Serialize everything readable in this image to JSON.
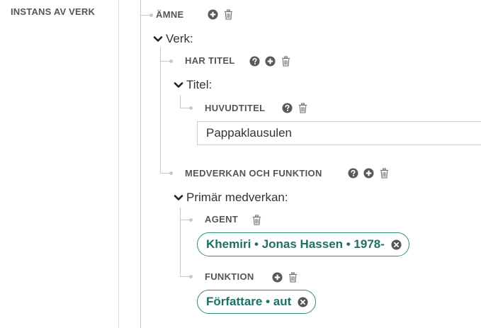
{
  "sidebar": {
    "label": "INSTANS AV VERK"
  },
  "tree": {
    "amne": {
      "label": "ÄMNE"
    },
    "verk": {
      "label": "Verk:",
      "har_titel": {
        "label": "HAR TITEL",
        "titel": {
          "label": "Titel:",
          "huvudtitel": {
            "label": "HUVUDTITEL",
            "value": "Pappaklausulen"
          }
        }
      },
      "medverkan": {
        "label": "MEDVERKAN OCH FUNKTION",
        "primar": {
          "label": "Primär medverkan:",
          "agent": {
            "label": "AGENT",
            "value": "Khemiri • Jonas Hassen • 1978-"
          },
          "funktion": {
            "label": "FUNKTION",
            "value": "Författare • aut"
          }
        }
      }
    }
  },
  "colors": {
    "accent": "#2c8a7e",
    "icon": "#595959",
    "line": "#c8c8c8"
  },
  "icons": [
    "help-icon",
    "add-icon",
    "trash-icon",
    "chevron-down-icon",
    "remove-icon"
  ]
}
